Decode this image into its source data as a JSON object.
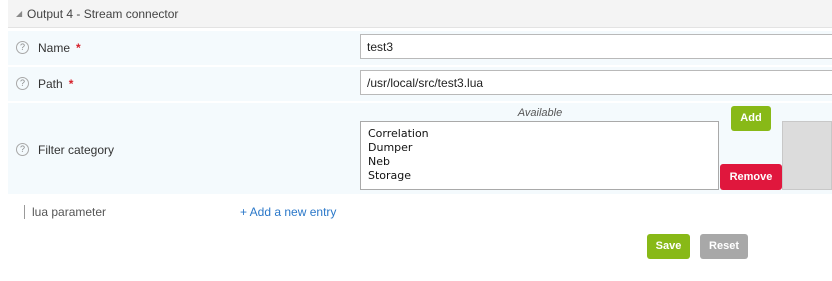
{
  "section": {
    "title": "Output 4 - Stream connector",
    "collapse_glyph": "◢"
  },
  "fields": {
    "name": {
      "label": "Name",
      "required_mark": "*",
      "value": "test3",
      "help_glyph": "?"
    },
    "path": {
      "label": "Path",
      "required_mark": "*",
      "value": "/usr/local/src/test3.lua",
      "help_glyph": "?"
    },
    "filter_category": {
      "label": "Filter category",
      "help_glyph": "?",
      "available_label": "Available",
      "available_options": [
        "Correlation",
        "Dumper",
        "Neb",
        "Storage"
      ],
      "add_label": "Add",
      "remove_label": "Remove"
    }
  },
  "lua_parameter": {
    "label": "lua parameter",
    "add_entry_label": "+ Add a new entry"
  },
  "actions": {
    "save_label": "Save",
    "reset_label": "Reset"
  },
  "colors": {
    "add": "#88b917",
    "save": "#88b917",
    "remove": "#e0173d",
    "reset": "#a8a8a8",
    "required": "#d6202a",
    "link": "#2b78c9"
  }
}
